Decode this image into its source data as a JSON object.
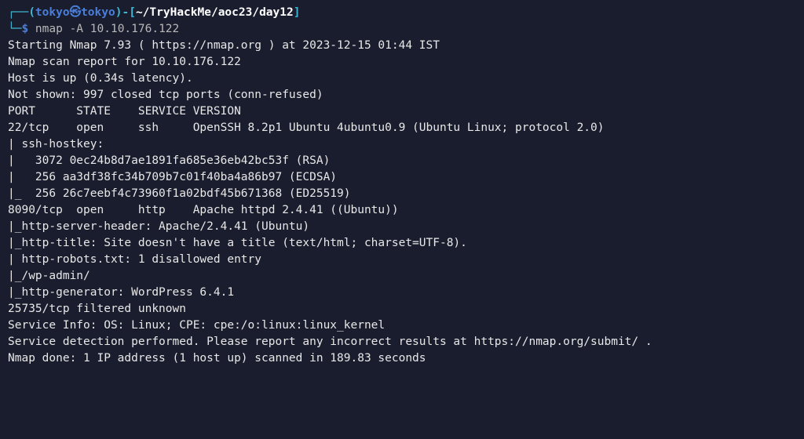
{
  "prompt": {
    "open_paren": "┌──(",
    "user": "tokyo",
    "skull": "㉿",
    "host": "tokyo",
    "close_user": ")",
    "dash_open": "-[",
    "tilde": "~",
    "path": "/TryHackMe/aoc23/day12",
    "close_bracket": "]",
    "line2_prefix": "└─",
    "dollar": "$",
    "command": " nmap -A 10.10.176.122"
  },
  "output": {
    "l1": "Starting Nmap 7.93 ( https://nmap.org ) at 2023-12-15 01:44 IST",
    "l2": "Nmap scan report for 10.10.176.122",
    "l3": "Host is up (0.34s latency).",
    "l4": "Not shown: 997 closed tcp ports (conn-refused)",
    "l5": "PORT      STATE    SERVICE VERSION",
    "l6": "22/tcp    open     ssh     OpenSSH 8.2p1 Ubuntu 4ubuntu0.9 (Ubuntu Linux; protocol 2.0)",
    "l7": "| ssh-hostkey:",
    "l8": "|   3072 0ec24b8d7ae1891fa685e36eb42bc53f (RSA)",
    "l9": "|   256 aa3df38fc34b709b7c01f40ba4a86b97 (ECDSA)",
    "l10": "|_  256 26c7eebf4c73960f1a02bdf45b671368 (ED25519)",
    "l11": "8090/tcp  open     http    Apache httpd 2.4.41 ((Ubuntu))",
    "l12": "|_http-server-header: Apache/2.4.41 (Ubuntu)",
    "l13": "|_http-title: Site doesn't have a title (text/html; charset=UTF-8).",
    "l14": "| http-robots.txt: 1 disallowed entry",
    "l15": "|_/wp-admin/",
    "l16": "|_http-generator: WordPress 6.4.1",
    "l17": "25735/tcp filtered unknown",
    "l18": "Service Info: OS: Linux; CPE: cpe:/o:linux:linux_kernel",
    "l19": "",
    "l20": "Service detection performed. Please report any incorrect results at https://nmap.org/submit/ .",
    "l21": "Nmap done: 1 IP address (1 host up) scanned in 189.83 seconds"
  }
}
